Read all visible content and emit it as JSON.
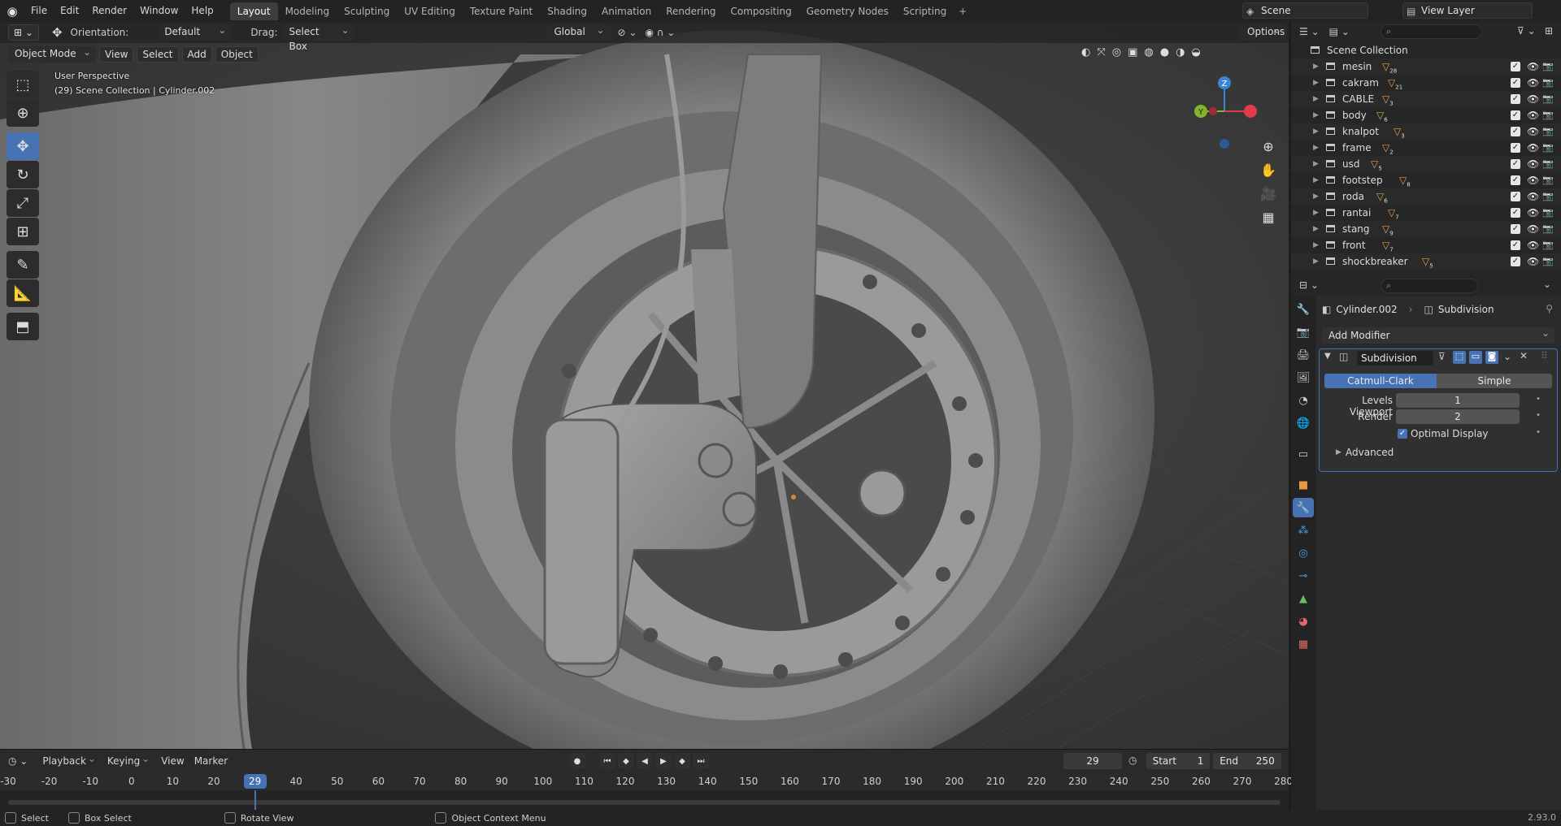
{
  "menu": {
    "items": [
      "File",
      "Edit",
      "Render",
      "Window",
      "Help"
    ]
  },
  "workspaces": {
    "tabs": [
      "Layout",
      "Modeling",
      "Sculpting",
      "UV Editing",
      "Texture Paint",
      "Shading",
      "Animation",
      "Rendering",
      "Compositing",
      "Geometry Nodes",
      "Scripting"
    ],
    "active": "Layout"
  },
  "scene": {
    "name": "Scene",
    "view_layer": "View Layer"
  },
  "viewport": {
    "mode": "Object Mode",
    "menus": [
      "View",
      "Select",
      "Add",
      "Object"
    ],
    "orientation_label": "Orientation:",
    "orientation_value": "Default",
    "drag_label": "Drag:",
    "drag_value": "Select Box",
    "transform_space": "Global",
    "options_label": "Options",
    "perspective_label": "User Perspective",
    "context_label": "(29) Scene Collection | Cylinder.002",
    "gizmo": {
      "z": "Z",
      "y": "Y"
    }
  },
  "outliner": {
    "root": "Scene Collection",
    "collections": [
      {
        "name": "mesin",
        "count": "28"
      },
      {
        "name": "cakram",
        "count": "21"
      },
      {
        "name": "CABLE",
        "count": "3"
      },
      {
        "name": "body",
        "count": "6"
      },
      {
        "name": "knalpot",
        "count": "3"
      },
      {
        "name": "frame",
        "count": "2"
      },
      {
        "name": "usd",
        "count": "5"
      },
      {
        "name": "footstep",
        "count": "8"
      },
      {
        "name": "roda",
        "count": "6"
      },
      {
        "name": "rantai",
        "count": "7"
      },
      {
        "name": "stang",
        "count": "9"
      },
      {
        "name": "front",
        "count": "7"
      },
      {
        "name": "shockbreaker",
        "count": "5"
      }
    ]
  },
  "properties": {
    "object": "Cylinder.002",
    "modifier_crumb": "Subdivision",
    "add_modifier": "Add Modifier",
    "modifier": {
      "name": "Subdivision",
      "mode_catmull": "Catmull-Clark",
      "mode_simple": "Simple",
      "active_mode": "Catmull-Clark",
      "levels_viewport_label": "Levels Viewport",
      "levels_viewport": "1",
      "render_label": "Render",
      "render": "2",
      "optimal_display_label": "Optimal Display",
      "optimal_display": true,
      "advanced_label": "Advanced"
    }
  },
  "timeline": {
    "menus": [
      "Playback",
      "Keying",
      "View",
      "Marker"
    ],
    "current_frame": "29",
    "start_label": "Start",
    "start": "1",
    "end_label": "End",
    "end": "250",
    "ruler": [
      "-30",
      "-20",
      "-10",
      "0",
      "10",
      "20",
      "29",
      "40",
      "50",
      "60",
      "70",
      "80",
      "90",
      "100",
      "110",
      "120",
      "130",
      "140",
      "150",
      "160",
      "170",
      "180",
      "190",
      "200",
      "210",
      "220",
      "230",
      "240",
      "250",
      "260",
      "270",
      "280"
    ]
  },
  "status": {
    "select": "Select",
    "box_select": "Box Select",
    "rotate_view": "Rotate View",
    "context_menu": "Object Context Menu",
    "version": "2.93.0"
  },
  "colors": {
    "accent": "#4772b3",
    "collection_badge": "#e5a04c",
    "gizmo_x": "#e33a4d",
    "gizmo_y": "#84b42a",
    "gizmo_z": "#3a84d6"
  }
}
